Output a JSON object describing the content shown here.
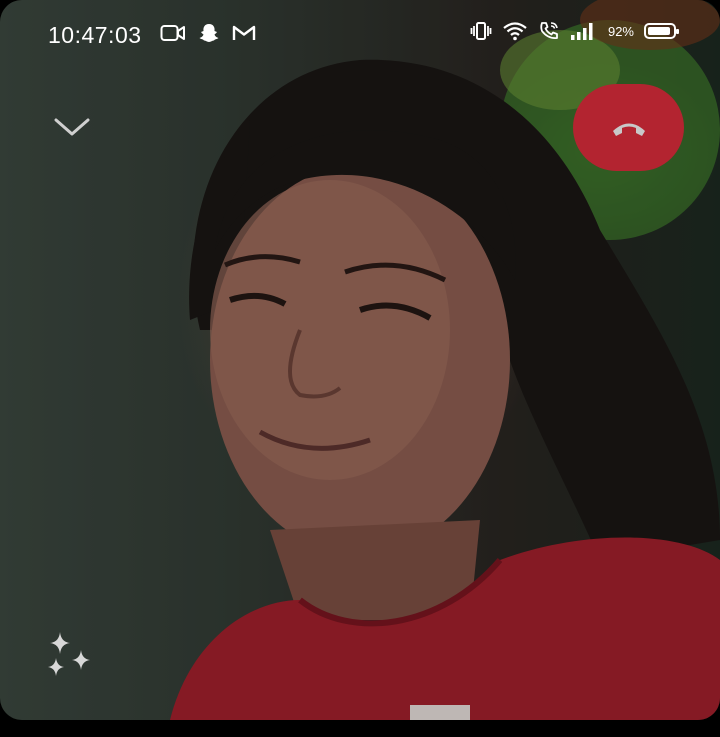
{
  "status_bar": {
    "time": "10:47:03",
    "battery_percent": "92%",
    "battery_level": 0.92,
    "left_icons": [
      "video-camera-icon",
      "snapchat-icon",
      "gmail-icon"
    ],
    "right_icons": [
      "vibrate-icon",
      "wifi-icon",
      "wifi-calling-icon",
      "signal-icon",
      "battery-icon"
    ]
  },
  "call": {
    "collapse_icon": "chevron-down-icon",
    "end_call_icon": "phone-hangup-icon",
    "end_call_color": "#b32430",
    "effects_icon": "sparkles-icon"
  }
}
